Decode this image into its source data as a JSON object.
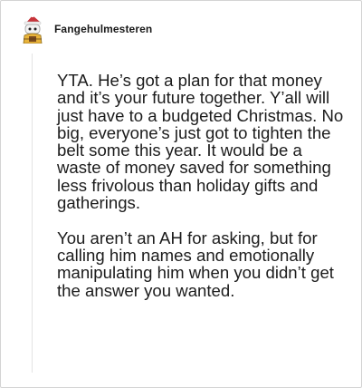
{
  "comment": {
    "username": "Fangehulmesteren",
    "paragraphs": [
      "YTA. He’s got a plan for that money and it’s your future together. Y’all will just have to a budgeted Christmas. No big, everyone’s just got to tighten the belt some this year. It would be a waste of money saved for something less frivolous than holiday gifts and gatherings.",
      "You aren’t an AH for asking, but for calling him names and emotionally manipulating him when you didn’t get the answer you wanted."
    ]
  },
  "colors": {
    "text": "#1c1c1c",
    "border": "#d4d4d4",
    "thread_line": "#e3e3e3",
    "avatar_hat": "#c7343a",
    "avatar_body": "#e8b33a"
  },
  "icons": {
    "avatar": "snoo-avatar-icon"
  }
}
